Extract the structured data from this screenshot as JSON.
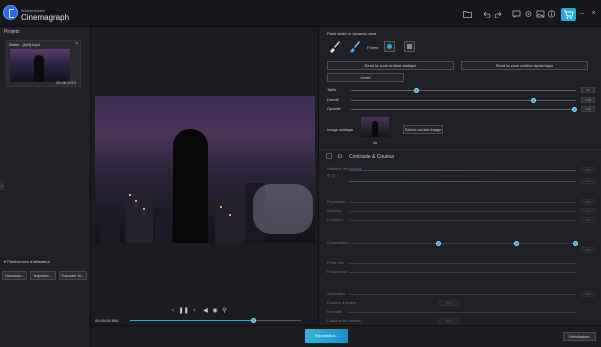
{
  "app": {
    "vendor": "Wondershare",
    "title": "Cinemagraph"
  },
  "toolbar": {
    "icons": [
      "folder-icon",
      "undo-icon",
      "redo-icon",
      "chat-icon",
      "settings-icon",
      "image-icon",
      "info-icon",
      "cart-icon",
      "minimize-icon",
      "close-icon"
    ],
    "window_controls": {
      "minimize": "–",
      "close": "×"
    }
  },
  "projects": {
    "title": "Projets",
    "items": [
      {
        "name": "Water - (left).mp4",
        "date": "25.08.2019"
      }
    ]
  },
  "preferences": {
    "title": "Préférences d'utilisateur",
    "buttons": [
      "Nouveau...",
      "Importer...",
      "Exporter to..."
    ]
  },
  "player": {
    "time": "00:00:04.866",
    "section_label": "Section",
    "progress": 0.72,
    "section_start": 0.45,
    "section_end": 0.78
  },
  "mask": {
    "title": "Paint static or dynamic area",
    "shape_label": "Forme",
    "btn_static_zone": "Rend la zone entière statique",
    "btn_dynamic_zone": "Rend la zone entière dynamique",
    "btn_invert": "Invert",
    "sliders": [
      {
        "label": "Taille",
        "value": "46",
        "pct": 0.29
      },
      {
        "label": "Dureté",
        "value": "1.00",
        "pct": 0.81
      },
      {
        "label": "Opacité",
        "value": "1.00",
        "pct": 0.99
      }
    ],
    "static_image_label": "Image statique",
    "static_image_sub": "ok",
    "select_current_label": "Select current image"
  },
  "color": {
    "title": "Contraste & Couleur",
    "balance_label": "Balance des blancs",
    "labels": [
      "Exposition",
      "Ombres",
      "Lumières",
      "Colorisation",
      "Point noir",
      "Point blanc",
      "Saturation",
      "Couleur d'ombre",
      "Intensité",
      "Couleur de lumière"
    ],
    "value_boxes": [
      "0.00",
      "0.00",
      "0.00",
      "0.00",
      "0.00",
      "0.00",
      "0.00",
      "0.00",
      "0.00"
    ]
  },
  "bottom": {
    "export_label": "Exportation...",
    "reinit_label": "Réinitialiser"
  },
  "colors": {
    "accent": "#2ea9d8",
    "background": "#1a1b1f",
    "panel": "#1f2025"
  }
}
